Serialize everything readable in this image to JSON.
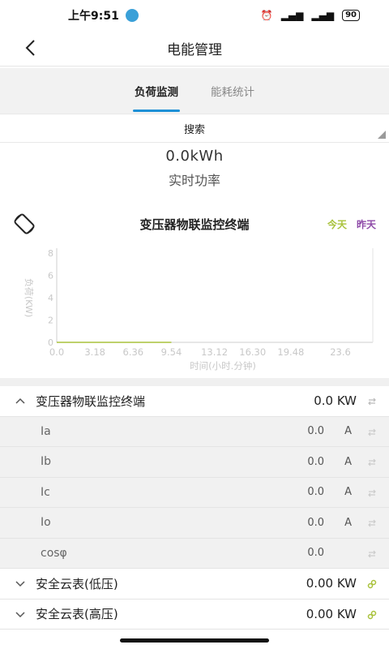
{
  "status": {
    "time": "上午9:51",
    "battery": "90"
  },
  "nav": {
    "title": "电能管理"
  },
  "tabs": [
    {
      "label": "负荷监测"
    },
    {
      "label": "能耗统计"
    }
  ],
  "search": {
    "label": "搜索"
  },
  "power": {
    "value": "0.0kWh",
    "label": "实时功率"
  },
  "chart_data": {
    "type": "line",
    "title": "变压器物联监控终端",
    "xlabel": "时间(小时.分钟)",
    "ylabel": "负荷(KW)",
    "x_ticks": [
      "0.0",
      "3.18",
      "6.36",
      "9.54",
      "13.12",
      "16.30",
      "19.48",
      "23.6"
    ],
    "y_ticks": [
      "0",
      "2",
      "4",
      "6",
      "8"
    ],
    "ylim": [
      0,
      8
    ],
    "legend": "top-right",
    "grid": false,
    "series": [
      {
        "name": "今天",
        "color": "#a9c23b",
        "x": [
          0.0,
          9.54
        ],
        "y": [
          0,
          0
        ]
      },
      {
        "name": "昨天",
        "color": "#8e4aa8",
        "x": [],
        "y": []
      }
    ]
  },
  "list": {
    "group1": {
      "label": "变压器物联监控终端",
      "value": "0.0 KW"
    },
    "subs": [
      {
        "label": "Ia",
        "value": "0.0",
        "unit": "A"
      },
      {
        "label": "Ib",
        "value": "0.0",
        "unit": "A"
      },
      {
        "label": "Ic",
        "value": "0.0",
        "unit": "A"
      },
      {
        "label": "Io",
        "value": "0.0",
        "unit": "A"
      },
      {
        "label": "cosφ",
        "value": "0.0",
        "unit": ""
      }
    ],
    "group2": {
      "label": "安全云表(低压)",
      "value": "0.00 KW"
    },
    "group3": {
      "label": "安全云表(高压)",
      "value": "0.00 KW"
    }
  }
}
